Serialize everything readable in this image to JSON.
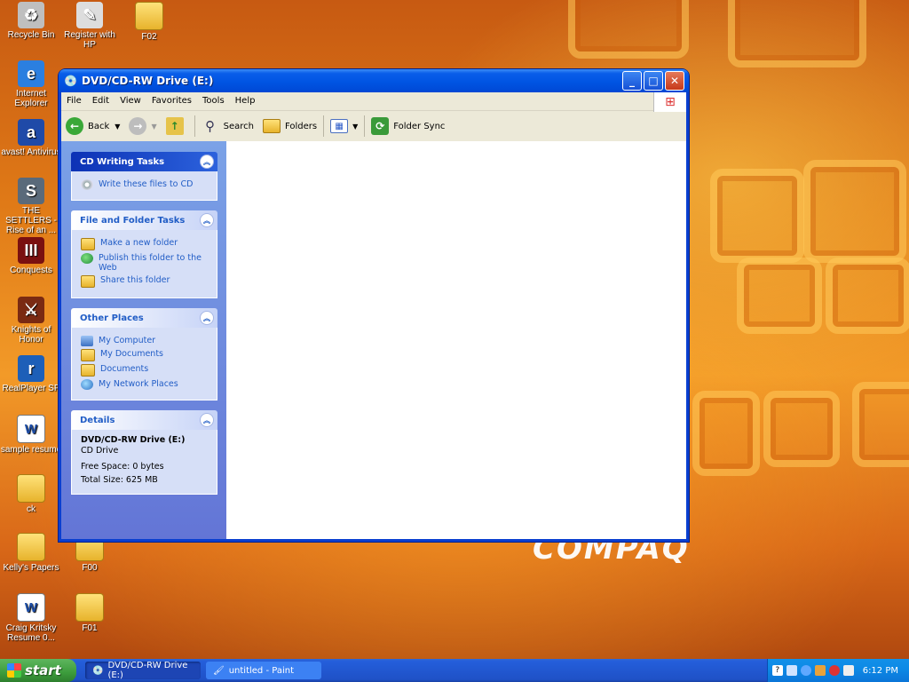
{
  "desktop": {
    "icons": [
      {
        "label": "Recycle Bin",
        "glyph": "♻",
        "color": "#bfbfbf"
      },
      {
        "label": "Register with HP",
        "glyph": "✎",
        "color": "#dddddd"
      },
      {
        "label": "F02",
        "glyph": "",
        "color": "folder"
      },
      {
        "label": "Internet Explorer",
        "glyph": "e",
        "color": "#2b7fe0"
      },
      {
        "label": "avast! Antivirus",
        "glyph": "a",
        "color": "#1f4aa8"
      },
      {
        "label": "THE SETTLERS - Rise of an ...",
        "glyph": "S",
        "color": "#5a6a7a"
      },
      {
        "label": "Conquests",
        "glyph": "III",
        "color": "#7a1010"
      },
      {
        "label": "Knights of Honor",
        "glyph": "⚔",
        "color": "#7a2a12"
      },
      {
        "label": "RealPlayer SP",
        "glyph": "r",
        "color": "#1d5fb8"
      },
      {
        "label": "sample resume",
        "glyph": "W",
        "color": "doc"
      },
      {
        "label": "ck",
        "glyph": "",
        "color": "folder"
      },
      {
        "label": "Kelly's Papers",
        "glyph": "",
        "color": "folder"
      },
      {
        "label": "F00",
        "glyph": "",
        "color": "folder"
      },
      {
        "label": "Craig Kritsky Resume 0...",
        "glyph": "W",
        "color": "doc"
      },
      {
        "label": "F01",
        "glyph": "",
        "color": "folder"
      }
    ],
    "brand_text": "COMPAQ"
  },
  "window": {
    "title": "DVD/CD-RW Drive (E:)",
    "buttons": {
      "minimize": "_",
      "maximize": "□",
      "close": "✕"
    },
    "menu": [
      "File",
      "Edit",
      "View",
      "Favorites",
      "Tools",
      "Help"
    ],
    "toolbar": {
      "back": "Back",
      "search": "Search",
      "folders": "Folders",
      "folder_sync": "Folder Sync"
    },
    "panels": {
      "cd_writing": {
        "title": "CD Writing Tasks",
        "items": [
          "Write these files to CD"
        ]
      },
      "file_folder": {
        "title": "File and Folder Tasks",
        "items": [
          "Make a new folder",
          "Publish this folder to the Web",
          "Share this folder"
        ]
      },
      "other_places": {
        "title": "Other Places",
        "items": [
          "My Computer",
          "My Documents",
          "Documents",
          "My Network Places"
        ]
      },
      "details": {
        "title": "Details",
        "name": "DVD/CD-RW Drive (E:)",
        "type": "CD Drive",
        "free_space": "Free Space: 0 bytes",
        "total_size": "Total Size: 625 MB"
      }
    }
  },
  "taskbar": {
    "start": "start",
    "tasks": [
      "DVD/CD-RW Drive (E:)",
      "untitled - Paint"
    ],
    "clock": "6:12 PM"
  }
}
